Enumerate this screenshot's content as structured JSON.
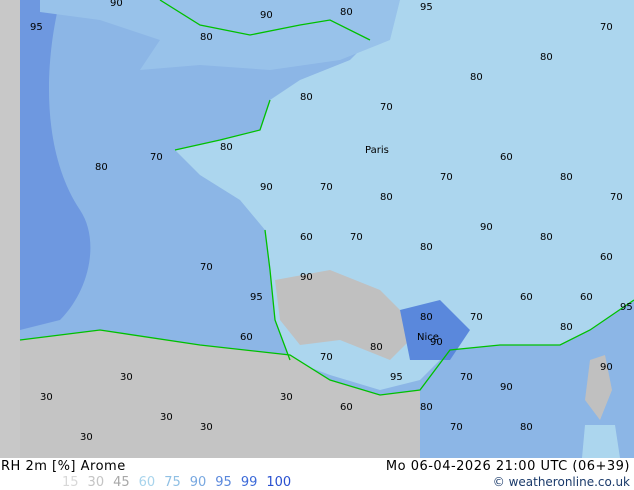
{
  "header": {
    "title": "RH 2m [%] Arome",
    "datetime": "Mo 06-04-2026 21:00 UTC (06+39)"
  },
  "legend": [
    {
      "label": "15",
      "color": "#d8d8d8"
    },
    {
      "label": "30",
      "color": "#c4c4c4"
    },
    {
      "label": "45",
      "color": "#a8a8a8"
    },
    {
      "label": "60",
      "color": "#a8d4ec"
    },
    {
      "label": "75",
      "color": "#90c0e4"
    },
    {
      "label": "90",
      "color": "#78a8e0"
    },
    {
      "label": "95",
      "color": "#5a88dc"
    },
    {
      "label": "99",
      "color": "#3c6ad8"
    },
    {
      "label": "100",
      "color": "#2850d0"
    }
  ],
  "credit": "© weatheronline.co.uk",
  "map": {
    "colors": {
      "sea": "#8cb6e6",
      "deep_sea": "#6e98e0",
      "land": "#acd6ee",
      "dry": "#c0c0c0",
      "border": "#00c000",
      "contour": "#808080"
    },
    "cities": [
      "Paris",
      "Nice"
    ],
    "contour_labels": [
      "95",
      "90",
      "80",
      "70",
      "80",
      "90",
      "80",
      "95",
      "80",
      "70",
      "80",
      "80",
      "70",
      "80",
      "90",
      "70",
      "80",
      "70",
      "60",
      "80",
      "70",
      "60",
      "70",
      "80",
      "90",
      "80",
      "60",
      "70",
      "95",
      "90",
      "80",
      "70",
      "60",
      "60",
      "30",
      "30",
      "30",
      "60",
      "70",
      "80",
      "95",
      "90",
      "30",
      "30",
      "30",
      "60",
      "80",
      "70",
      "90",
      "80",
      "95",
      "90",
      "80",
      "70"
    ]
  }
}
